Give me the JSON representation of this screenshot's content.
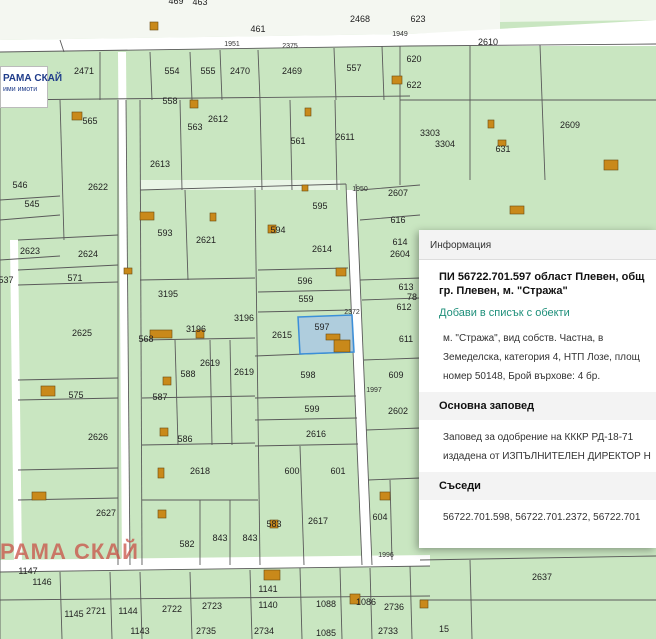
{
  "map": {
    "parcels": [
      {
        "id": "p469",
        "label": "469"
      },
      {
        "id": "p463",
        "label": "463"
      },
      {
        "id": "p461",
        "label": "461"
      },
      {
        "id": "p2468",
        "label": "2468"
      },
      {
        "id": "p623",
        "label": "623"
      },
      {
        "id": "p1951",
        "label": "1951"
      },
      {
        "id": "p2375",
        "label": "2375"
      },
      {
        "id": "p1949",
        "label": "1949"
      },
      {
        "id": "p2610",
        "label": "2610"
      },
      {
        "id": "p2471",
        "label": "2471"
      },
      {
        "id": "p554",
        "label": "554"
      },
      {
        "id": "p555",
        "label": "555"
      },
      {
        "id": "p2470",
        "label": "2470"
      },
      {
        "id": "p2469",
        "label": "2469"
      },
      {
        "id": "p557",
        "label": "557"
      },
      {
        "id": "p620",
        "label": "620"
      },
      {
        "id": "p622",
        "label": "622"
      },
      {
        "id": "p558",
        "label": "558"
      },
      {
        "id": "p565",
        "label": "565"
      },
      {
        "id": "p563",
        "label": "563"
      },
      {
        "id": "p2612",
        "label": "2612"
      },
      {
        "id": "p3303",
        "label": "3303"
      },
      {
        "id": "p2609",
        "label": "2609"
      },
      {
        "id": "p561",
        "label": "561"
      },
      {
        "id": "p2611",
        "label": "2611"
      },
      {
        "id": "p3304",
        "label": "3304"
      },
      {
        "id": "p631",
        "label": "631"
      },
      {
        "id": "p2613",
        "label": "2613"
      },
      {
        "id": "p546",
        "label": "546"
      },
      {
        "id": "p2622",
        "label": "2622"
      },
      {
        "id": "p1950",
        "label": "1950"
      },
      {
        "id": "p2607",
        "label": "2607"
      },
      {
        "id": "p545",
        "label": "545"
      },
      {
        "id": "p595",
        "label": "595"
      },
      {
        "id": "p616",
        "label": "616"
      },
      {
        "id": "p593",
        "label": "593"
      },
      {
        "id": "p2621",
        "label": "2621"
      },
      {
        "id": "p594",
        "label": "594"
      },
      {
        "id": "p614",
        "label": "614"
      },
      {
        "id": "p2614",
        "label": "2614"
      },
      {
        "id": "p2623",
        "label": "2623"
      },
      {
        "id": "p2624",
        "label": "2624"
      },
      {
        "id": "p2604",
        "label": "2604"
      },
      {
        "id": "p571",
        "label": "571"
      },
      {
        "id": "p537",
        "label": "537"
      },
      {
        "id": "p596",
        "label": "596"
      },
      {
        "id": "p613",
        "label": "613"
      },
      {
        "id": "p3195",
        "label": "3195"
      },
      {
        "id": "p559",
        "label": "559"
      },
      {
        "id": "p2372",
        "label": "2372"
      },
      {
        "id": "p612",
        "label": "612"
      },
      {
        "id": "p2625",
        "label": "2625"
      },
      {
        "id": "p3196",
        "label": "3196"
      },
      {
        "id": "p3196b",
        "label": "3196"
      },
      {
        "id": "p2615",
        "label": "2615"
      },
      {
        "id": "p597",
        "label": "597"
      },
      {
        "id": "p611",
        "label": "611"
      },
      {
        "id": "p568",
        "label": "568"
      },
      {
        "id": "p2619",
        "label": "2619"
      },
      {
        "id": "p588",
        "label": "588"
      },
      {
        "id": "p2619b",
        "label": "2619"
      },
      {
        "id": "p598",
        "label": "598"
      },
      {
        "id": "p609",
        "label": "609"
      },
      {
        "id": "p575",
        "label": "575"
      },
      {
        "id": "p587",
        "label": "587"
      },
      {
        "id": "p1997",
        "label": "1997"
      },
      {
        "id": "p599",
        "label": "599"
      },
      {
        "id": "p2602",
        "label": "2602"
      },
      {
        "id": "p2626",
        "label": "2626"
      },
      {
        "id": "p586",
        "label": "586"
      },
      {
        "id": "p2616",
        "label": "2616"
      },
      {
        "id": "p2618",
        "label": "2618"
      },
      {
        "id": "p600",
        "label": "600"
      },
      {
        "id": "p601",
        "label": "601"
      },
      {
        "id": "p2627",
        "label": "2627"
      },
      {
        "id": "p604",
        "label": "604"
      },
      {
        "id": "p583",
        "label": "583"
      },
      {
        "id": "p2617",
        "label": "2617"
      },
      {
        "id": "p582",
        "label": "582"
      },
      {
        "id": "p843",
        "label": "843"
      },
      {
        "id": "p843b",
        "label": "843"
      },
      {
        "id": "p1996",
        "label": "1996"
      },
      {
        "id": "p1147",
        "label": "1147"
      },
      {
        "id": "p1146",
        "label": "1146"
      },
      {
        "id": "p1141",
        "label": "1141"
      },
      {
        "id": "p2637",
        "label": "2637"
      },
      {
        "id": "p1145",
        "label": "1145"
      },
      {
        "id": "p2721",
        "label": "2721"
      },
      {
        "id": "p1144",
        "label": "1144"
      },
      {
        "id": "p2722",
        "label": "2722"
      },
      {
        "id": "p2723",
        "label": "2723"
      },
      {
        "id": "p1140",
        "label": "1140"
      },
      {
        "id": "p1088",
        "label": "1088"
      },
      {
        "id": "p1086",
        "label": "1086"
      },
      {
        "id": "p2736",
        "label": "2736"
      },
      {
        "id": "p1143",
        "label": "1143"
      },
      {
        "id": "p2735",
        "label": "2735"
      },
      {
        "id": "p2734",
        "label": "2734"
      },
      {
        "id": "p1085",
        "label": "1085"
      },
      {
        "id": "p2733",
        "label": "2733"
      },
      {
        "id": "p78",
        "label": "78"
      },
      {
        "id": "p15",
        "label": "15"
      }
    ],
    "colors": {
      "land": "#c9e6c1",
      "parcel_line": "#5a5a5a",
      "road": "#ffffff",
      "building": "#c9891a",
      "highlight": "#3b8fd9",
      "highlight_fill": "#a9c7e3"
    }
  },
  "logo": {
    "line1": "РАМА СКАЙ",
    "line2": "ими имоти"
  },
  "watermark": "РАМА СКАЙ",
  "panel": {
    "header": "Информация",
    "title_line1": "ПИ 56722.701.597 област Плевен, общ",
    "title_line2": "гр. Плевен, м. \"Стража\"",
    "add_link": "Добави в списък с обекти",
    "desc_line1": "м. \"Стража\", вид собств. Частна, в",
    "desc_line2": "Земеделска, категория 4, НТП Лозе, площ",
    "desc_line3": "номер 50148, Брой върхове: 4 бр.",
    "order_heading": "Основна заповед",
    "order_line1": "Заповед за одобрение на КККР РД-18-71",
    "order_line2": "издадена от ИЗПЪЛНИТЕЛЕН ДИРЕКТОР Н",
    "neighbors_heading": "Съседи",
    "neighbors_line": "56722.701.598, 56722.701.2372, 56722.701"
  }
}
